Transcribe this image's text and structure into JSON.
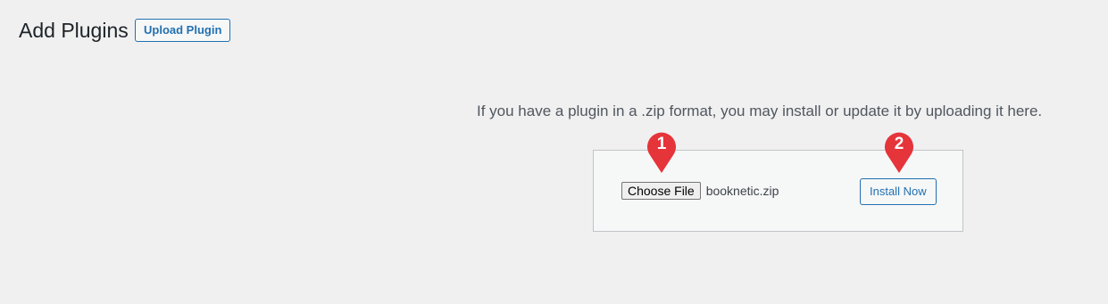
{
  "header": {
    "title": "Add Plugins",
    "upload_button_label": "Upload Plugin"
  },
  "upload": {
    "help_text": "If you have a plugin in a .zip format, you may install or update it by uploading it here.",
    "choose_file_label": "Choose File",
    "file_name": "booknetic.zip",
    "install_button_label": "Install Now"
  },
  "annotations": {
    "marker_1": "1",
    "marker_2": "2",
    "marker_color": "#e5343a"
  },
  "colors": {
    "accent": "#2271b1",
    "background": "#f0f0f1"
  }
}
